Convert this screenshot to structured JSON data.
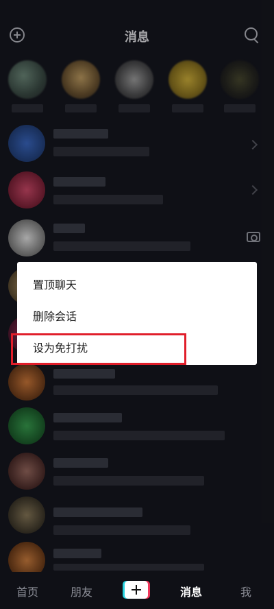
{
  "header": {
    "title": "消息",
    "left_icon": "add-circle-icon",
    "right_icon": "search-icon"
  },
  "context_menu": {
    "items": [
      {
        "label": "置顶聊天"
      },
      {
        "label": "删除会话"
      },
      {
        "label": "设为免打扰"
      }
    ],
    "highlighted_item": "设为免打扰",
    "highlight_color": "#e01e2a"
  },
  "tabbar": {
    "items": [
      {
        "label": "首页"
      },
      {
        "label": "朋友"
      },
      {
        "label": ""
      },
      {
        "label": "消息"
      },
      {
        "label": "我"
      }
    ],
    "active": "消息"
  },
  "colors": {
    "background": "#16171f",
    "menu_bg": "#ffffff"
  }
}
